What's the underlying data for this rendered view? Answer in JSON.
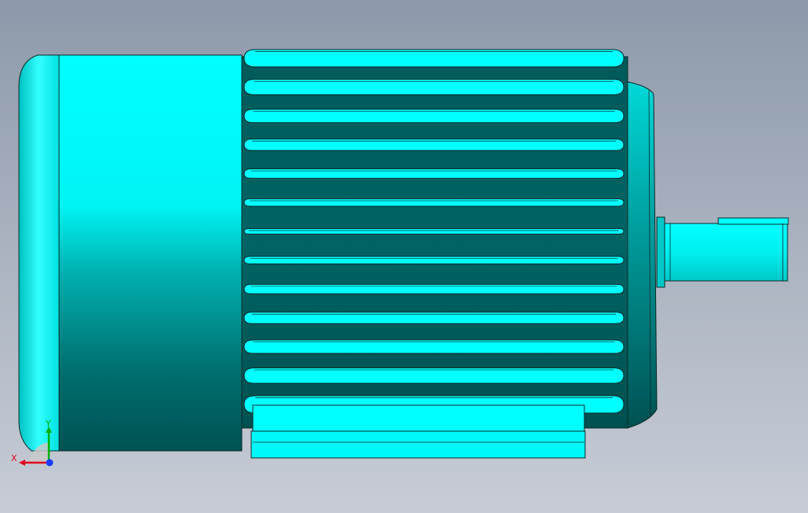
{
  "viewport": {
    "background_top": "#8d99aa",
    "background_bottom": "#c7ccd6"
  },
  "model": {
    "body_color": "#00ffff",
    "shade_color": "#005a5a",
    "edge_color": "#0b2a2a",
    "fin_count": 13,
    "parts": [
      "fan-cover",
      "motor-frame",
      "cooling-fins",
      "end-shield",
      "shaft",
      "shaft-key",
      "mounting-foot"
    ]
  },
  "triad": {
    "x_label": "X",
    "y_label": "Y",
    "x_color": "#e0001b",
    "y_color": "#00b000",
    "z_color": "#1a3cff",
    "icon": "coordinate-triad-icon"
  }
}
